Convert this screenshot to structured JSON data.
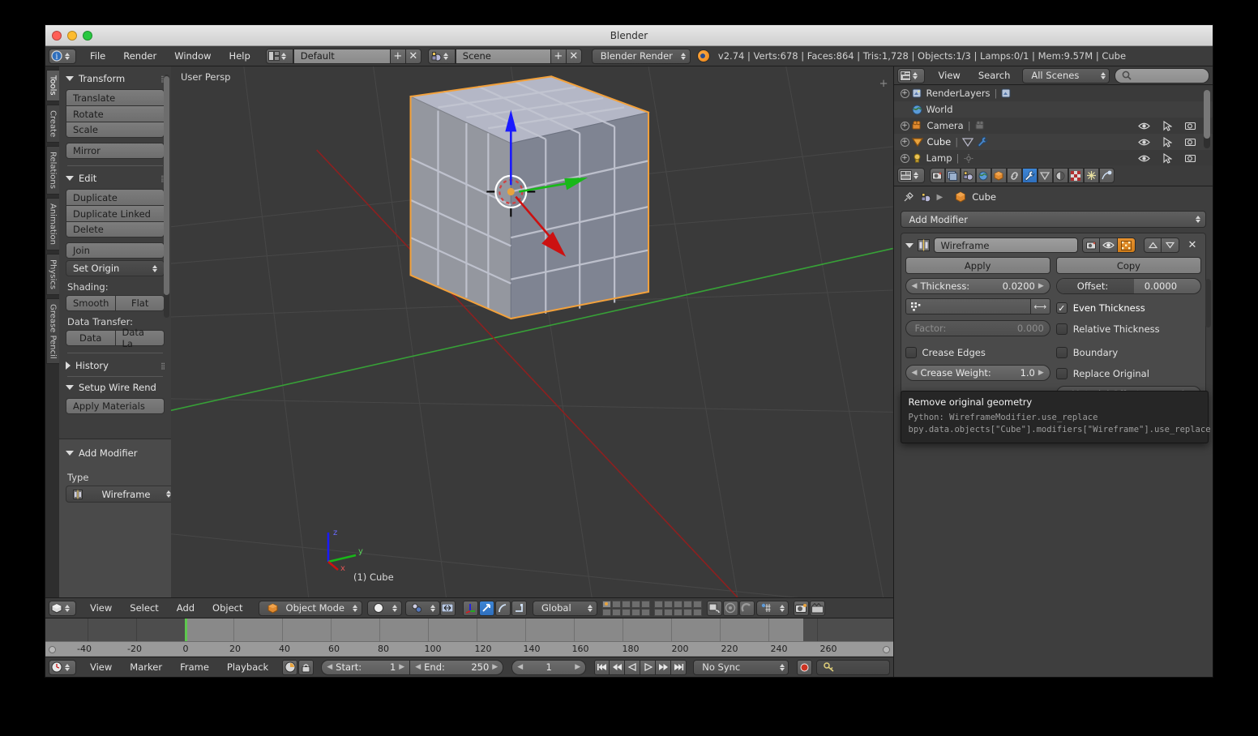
{
  "window": {
    "title": "Blender"
  },
  "infobar": {
    "menus": [
      "File",
      "Render",
      "Window",
      "Help"
    ],
    "screen_layout": "Default",
    "scene": "Scene",
    "engine": "Blender Render",
    "stats": "v2.74 | Verts:678 | Faces:864 | Tris:1,728 | Objects:1/3 | Lamps:0/1 | Mem:9.57M | Cube",
    "icons": {
      "editor": "info-editor-icon",
      "layout": "screen-layout-icon",
      "scene": "scene-icon",
      "add": "+",
      "remove": "✕",
      "logo": "blender-logo-icon"
    }
  },
  "toolshelf": {
    "tabs": [
      "Tools",
      "Create",
      "Relations",
      "Animation",
      "Physics",
      "Grease Pencil"
    ],
    "active_tab": "Tools",
    "panels": [
      {
        "title": "Transform",
        "buttons": [
          "Translate",
          "Rotate",
          "Scale",
          "Mirror"
        ]
      },
      {
        "title": "Edit",
        "buttons": [
          "Duplicate",
          "Duplicate Linked",
          "Delete",
          "Join"
        ],
        "dropdown": "Set Origin",
        "shading_label": "Shading:",
        "shading_options": [
          "Smooth",
          "Flat"
        ],
        "data_transfer_label": "Data Transfer:",
        "data_transfer_options": [
          "Data",
          "Data La"
        ]
      },
      {
        "title": "History",
        "collapsed": true
      },
      {
        "title": "Setup Wire Rend",
        "buttons": [
          "Apply Materials"
        ]
      }
    ]
  },
  "addmod_panel": {
    "title": "Add Modifier",
    "type_label": "Type",
    "type_value": "Wireframe"
  },
  "viewport": {
    "perspective_label": "User Persp",
    "object_label": "(1) Cube",
    "axis_labels": {
      "x": "x",
      "y": "y",
      "z": "z"
    },
    "colors": {
      "background": "#3a3a3a",
      "outline": "#e8a33d",
      "axis_x": "#cc2222",
      "axis_y": "#37a037",
      "axis_z": "#2222cc"
    }
  },
  "viewport_footer": {
    "menus": [
      "View",
      "Select",
      "Add",
      "Object"
    ],
    "mode": "Object Mode",
    "transform_orientation": "Global",
    "icons": [
      "editor-type-icon",
      "mode-icon",
      "viewport-shading-icon",
      "pivot-icon",
      "manipulator-icon",
      "translate-manipulator-icon",
      "rotate-manipulator-icon",
      "scale-manipulator-icon",
      "layers-icon",
      "lock-icon",
      "proportional-edit-icon",
      "snap-magnet-icon",
      "snap-element-icon",
      "render-preview-icon",
      "opengl-render-icon"
    ]
  },
  "outliner": {
    "menus": [
      "View",
      "Search"
    ],
    "display_mode": "All Scenes",
    "search_placeholder": "",
    "rows": [
      {
        "label": "RenderLayers",
        "icon": "render-layers-icon",
        "expandable": true,
        "has_datablock": true,
        "show_toggles": false
      },
      {
        "label": "World",
        "icon": "world-icon",
        "expandable": false,
        "has_datablock": false,
        "show_toggles": false
      },
      {
        "label": "Camera",
        "icon": "camera-icon",
        "expandable": true,
        "has_datablock": true,
        "show_toggles": true
      },
      {
        "label": "Cube",
        "icon": "mesh-icon",
        "expandable": true,
        "has_datablock": true,
        "show_toggles": true,
        "selected": true
      },
      {
        "label": "Lamp",
        "icon": "lamp-icon",
        "expandable": true,
        "has_datablock": true,
        "show_toggles": true
      }
    ],
    "toggle_icons": [
      "eye-icon",
      "cursor-arrow-icon",
      "camera-render-icon"
    ]
  },
  "properties": {
    "tabs": [
      "render-tab",
      "render-layers-tab",
      "scene-tab",
      "world-tab",
      "object-tab",
      "constraints-tab",
      "modifiers-tab",
      "data-tab",
      "material-tab",
      "texture-tab",
      "particles-tab",
      "physics-tab"
    ],
    "active_tab": "modifiers-tab",
    "breadcrumb": {
      "pin": "pin-icon",
      "scene_icon": "scene-icon",
      "object": "Cube"
    },
    "add_modifier_label": "Add Modifier",
    "modifier": {
      "icon": "wireframe-modifier-icon",
      "name": "Wireframe",
      "header_toggles": [
        "render-toggle-icon",
        "realtime-toggle-icon",
        "editmode-toggle-icon"
      ],
      "move_up": "▲",
      "move_down": "▼",
      "delete": "✕",
      "apply_label": "Apply",
      "copy_label": "Copy",
      "fields": [
        {
          "label": "Thickness:",
          "value": "0.0200"
        },
        {
          "label": "Offset:",
          "value": "0.0000"
        },
        {
          "label": "Factor:",
          "value": "0.000",
          "disabled": true
        },
        {
          "label": "Crease Weight:",
          "value": "1.0"
        },
        {
          "label": "Material Offset:",
          "value": "0",
          "disabled": true
        }
      ],
      "vertex_group_placeholder": "",
      "checkboxes": [
        {
          "label": "Even Thickness",
          "checked": true
        },
        {
          "label": "Relative Thickness",
          "checked": false
        },
        {
          "label": "Crease Edges",
          "checked": false
        },
        {
          "label": "Boundary",
          "checked": false
        },
        {
          "label": "Replace Original",
          "checked": false
        }
      ]
    }
  },
  "tooltip": {
    "title": "Remove original geometry",
    "python_line1": "Python: WireframeModifier.use_replace",
    "python_line2": "bpy.data.objects[\"Cube\"].modifiers[\"Wireframe\"].use_replace"
  },
  "timeline": {
    "ticks": [
      "-40",
      "-20",
      "0",
      "20",
      "40",
      "60",
      "80",
      "100",
      "120",
      "140",
      "160",
      "180",
      "200",
      "220",
      "240",
      "260"
    ],
    "menus": [
      "View",
      "Marker",
      "Frame",
      "Playback"
    ],
    "start_label": "Start:",
    "start_value": "1",
    "end_label": "End:",
    "end_value": "250",
    "current_frame": "1",
    "sync_mode": "No Sync",
    "playhead_frame": 0
  }
}
